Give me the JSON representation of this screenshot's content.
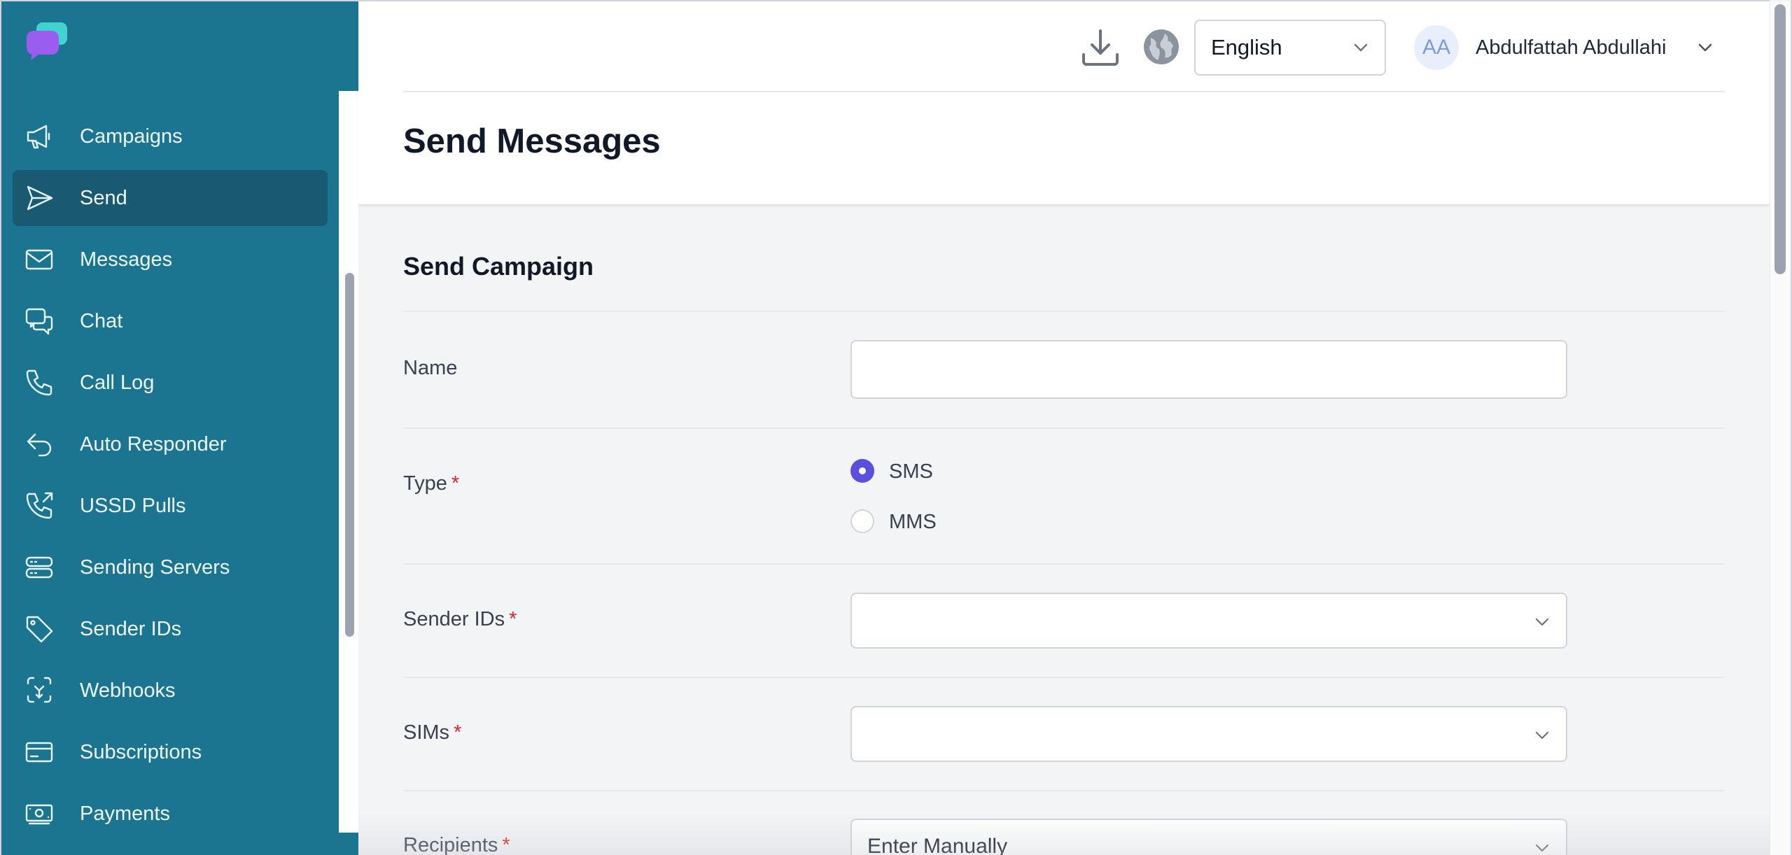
{
  "sidebar": {
    "items": [
      {
        "label": "Campaigns",
        "icon": "megaphone-icon"
      },
      {
        "label": "Send",
        "icon": "send-icon",
        "active": true
      },
      {
        "label": "Messages",
        "icon": "envelope-icon"
      },
      {
        "label": "Chat",
        "icon": "chat-icon"
      },
      {
        "label": "Call Log",
        "icon": "phone-icon"
      },
      {
        "label": "Auto Responder",
        "icon": "reply-icon"
      },
      {
        "label": "USSD Pulls",
        "icon": "phone-arrow-icon"
      },
      {
        "label": "Sending Servers",
        "icon": "server-icon"
      },
      {
        "label": "Sender IDs",
        "icon": "tag-icon"
      },
      {
        "label": "Webhooks",
        "icon": "webhook-icon"
      },
      {
        "label": "Subscriptions",
        "icon": "credit-card-icon"
      },
      {
        "label": "Payments",
        "icon": "banknote-icon"
      }
    ]
  },
  "header": {
    "language": "English",
    "user_initials": "AA",
    "user_name": "Abdulfattah Abdullahi"
  },
  "page": {
    "title": "Send Messages"
  },
  "form": {
    "section_title": "Send Campaign",
    "name_label": "Name",
    "name_value": "",
    "type_label": "Type",
    "type_options": [
      "SMS",
      "MMS"
    ],
    "type_selected": "SMS",
    "sender_ids_label": "Sender IDs",
    "sender_ids_value": "",
    "sims_label": "SIMs",
    "sims_value": "",
    "recipients_label": "Recipients",
    "recipients_value": "Enter Manually",
    "required_marker": "*"
  },
  "colors": {
    "sidebar_bg": "#1b7590",
    "sidebar_active": "#195a72",
    "radio_accent": "#5b4fe0",
    "required": "#dc2626"
  }
}
